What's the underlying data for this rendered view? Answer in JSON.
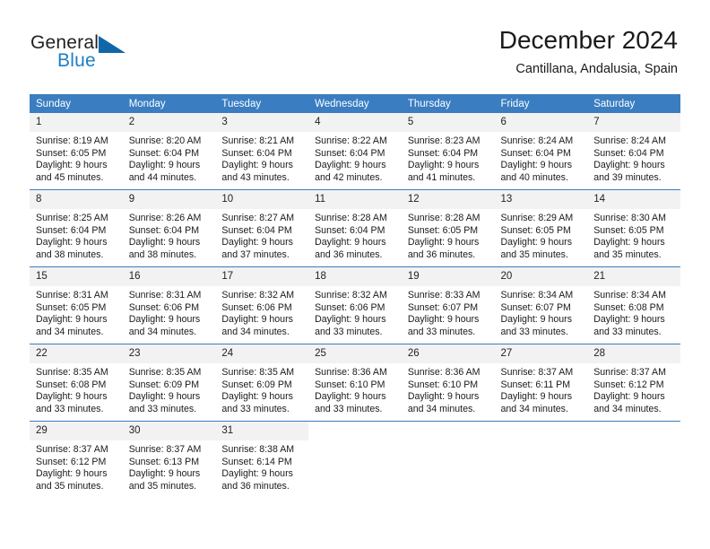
{
  "logo": {
    "word1": "General",
    "word2": "Blue",
    "triangle_color": "#1067a8",
    "blue_color": "#1b7fc4"
  },
  "header": {
    "title": "December 2024",
    "subtitle": "Cantillana, Andalusia, Spain"
  },
  "theme": {
    "header_blue": "#3a7dc1",
    "daynum_band": "#f2f2f2",
    "text": "#1a1a1a"
  },
  "weekday_headers": [
    "Sunday",
    "Monday",
    "Tuesday",
    "Wednesday",
    "Thursday",
    "Friday",
    "Saturday"
  ],
  "weeks": [
    [
      {
        "day": "1",
        "sunrise": "Sunrise: 8:19 AM",
        "sunset": "Sunset: 6:05 PM",
        "daylight_line1": "Daylight: 9 hours",
        "daylight_line2": "and 45 minutes."
      },
      {
        "day": "2",
        "sunrise": "Sunrise: 8:20 AM",
        "sunset": "Sunset: 6:04 PM",
        "daylight_line1": "Daylight: 9 hours",
        "daylight_line2": "and 44 minutes."
      },
      {
        "day": "3",
        "sunrise": "Sunrise: 8:21 AM",
        "sunset": "Sunset: 6:04 PM",
        "daylight_line1": "Daylight: 9 hours",
        "daylight_line2": "and 43 minutes."
      },
      {
        "day": "4",
        "sunrise": "Sunrise: 8:22 AM",
        "sunset": "Sunset: 6:04 PM",
        "daylight_line1": "Daylight: 9 hours",
        "daylight_line2": "and 42 minutes."
      },
      {
        "day": "5",
        "sunrise": "Sunrise: 8:23 AM",
        "sunset": "Sunset: 6:04 PM",
        "daylight_line1": "Daylight: 9 hours",
        "daylight_line2": "and 41 minutes."
      },
      {
        "day": "6",
        "sunrise": "Sunrise: 8:24 AM",
        "sunset": "Sunset: 6:04 PM",
        "daylight_line1": "Daylight: 9 hours",
        "daylight_line2": "and 40 minutes."
      },
      {
        "day": "7",
        "sunrise": "Sunrise: 8:24 AM",
        "sunset": "Sunset: 6:04 PM",
        "daylight_line1": "Daylight: 9 hours",
        "daylight_line2": "and 39 minutes."
      }
    ],
    [
      {
        "day": "8",
        "sunrise": "Sunrise: 8:25 AM",
        "sunset": "Sunset: 6:04 PM",
        "daylight_line1": "Daylight: 9 hours",
        "daylight_line2": "and 38 minutes."
      },
      {
        "day": "9",
        "sunrise": "Sunrise: 8:26 AM",
        "sunset": "Sunset: 6:04 PM",
        "daylight_line1": "Daylight: 9 hours",
        "daylight_line2": "and 38 minutes."
      },
      {
        "day": "10",
        "sunrise": "Sunrise: 8:27 AM",
        "sunset": "Sunset: 6:04 PM",
        "daylight_line1": "Daylight: 9 hours",
        "daylight_line2": "and 37 minutes."
      },
      {
        "day": "11",
        "sunrise": "Sunrise: 8:28 AM",
        "sunset": "Sunset: 6:04 PM",
        "daylight_line1": "Daylight: 9 hours",
        "daylight_line2": "and 36 minutes."
      },
      {
        "day": "12",
        "sunrise": "Sunrise: 8:28 AM",
        "sunset": "Sunset: 6:05 PM",
        "daylight_line1": "Daylight: 9 hours",
        "daylight_line2": "and 36 minutes."
      },
      {
        "day": "13",
        "sunrise": "Sunrise: 8:29 AM",
        "sunset": "Sunset: 6:05 PM",
        "daylight_line1": "Daylight: 9 hours",
        "daylight_line2": "and 35 minutes."
      },
      {
        "day": "14",
        "sunrise": "Sunrise: 8:30 AM",
        "sunset": "Sunset: 6:05 PM",
        "daylight_line1": "Daylight: 9 hours",
        "daylight_line2": "and 35 minutes."
      }
    ],
    [
      {
        "day": "15",
        "sunrise": "Sunrise: 8:31 AM",
        "sunset": "Sunset: 6:05 PM",
        "daylight_line1": "Daylight: 9 hours",
        "daylight_line2": "and 34 minutes."
      },
      {
        "day": "16",
        "sunrise": "Sunrise: 8:31 AM",
        "sunset": "Sunset: 6:06 PM",
        "daylight_line1": "Daylight: 9 hours",
        "daylight_line2": "and 34 minutes."
      },
      {
        "day": "17",
        "sunrise": "Sunrise: 8:32 AM",
        "sunset": "Sunset: 6:06 PM",
        "daylight_line1": "Daylight: 9 hours",
        "daylight_line2": "and 34 minutes."
      },
      {
        "day": "18",
        "sunrise": "Sunrise: 8:32 AM",
        "sunset": "Sunset: 6:06 PM",
        "daylight_line1": "Daylight: 9 hours",
        "daylight_line2": "and 33 minutes."
      },
      {
        "day": "19",
        "sunrise": "Sunrise: 8:33 AM",
        "sunset": "Sunset: 6:07 PM",
        "daylight_line1": "Daylight: 9 hours",
        "daylight_line2": "and 33 minutes."
      },
      {
        "day": "20",
        "sunrise": "Sunrise: 8:34 AM",
        "sunset": "Sunset: 6:07 PM",
        "daylight_line1": "Daylight: 9 hours",
        "daylight_line2": "and 33 minutes."
      },
      {
        "day": "21",
        "sunrise": "Sunrise: 8:34 AM",
        "sunset": "Sunset: 6:08 PM",
        "daylight_line1": "Daylight: 9 hours",
        "daylight_line2": "and 33 minutes."
      }
    ],
    [
      {
        "day": "22",
        "sunrise": "Sunrise: 8:35 AM",
        "sunset": "Sunset: 6:08 PM",
        "daylight_line1": "Daylight: 9 hours",
        "daylight_line2": "and 33 minutes."
      },
      {
        "day": "23",
        "sunrise": "Sunrise: 8:35 AM",
        "sunset": "Sunset: 6:09 PM",
        "daylight_line1": "Daylight: 9 hours",
        "daylight_line2": "and 33 minutes."
      },
      {
        "day": "24",
        "sunrise": "Sunrise: 8:35 AM",
        "sunset": "Sunset: 6:09 PM",
        "daylight_line1": "Daylight: 9 hours",
        "daylight_line2": "and 33 minutes."
      },
      {
        "day": "25",
        "sunrise": "Sunrise: 8:36 AM",
        "sunset": "Sunset: 6:10 PM",
        "daylight_line1": "Daylight: 9 hours",
        "daylight_line2": "and 33 minutes."
      },
      {
        "day": "26",
        "sunrise": "Sunrise: 8:36 AM",
        "sunset": "Sunset: 6:10 PM",
        "daylight_line1": "Daylight: 9 hours",
        "daylight_line2": "and 34 minutes."
      },
      {
        "day": "27",
        "sunrise": "Sunrise: 8:37 AM",
        "sunset": "Sunset: 6:11 PM",
        "daylight_line1": "Daylight: 9 hours",
        "daylight_line2": "and 34 minutes."
      },
      {
        "day": "28",
        "sunrise": "Sunrise: 8:37 AM",
        "sunset": "Sunset: 6:12 PM",
        "daylight_line1": "Daylight: 9 hours",
        "daylight_line2": "and 34 minutes."
      }
    ],
    [
      {
        "day": "29",
        "sunrise": "Sunrise: 8:37 AM",
        "sunset": "Sunset: 6:12 PM",
        "daylight_line1": "Daylight: 9 hours",
        "daylight_line2": "and 35 minutes."
      },
      {
        "day": "30",
        "sunrise": "Sunrise: 8:37 AM",
        "sunset": "Sunset: 6:13 PM",
        "daylight_line1": "Daylight: 9 hours",
        "daylight_line2": "and 35 minutes."
      },
      {
        "day": "31",
        "sunrise": "Sunrise: 8:38 AM",
        "sunset": "Sunset: 6:14 PM",
        "daylight_line1": "Daylight: 9 hours",
        "daylight_line2": "and 36 minutes."
      },
      {
        "day": "",
        "sunrise": "",
        "sunset": "",
        "daylight_line1": "",
        "daylight_line2": ""
      },
      {
        "day": "",
        "sunrise": "",
        "sunset": "",
        "daylight_line1": "",
        "daylight_line2": ""
      },
      {
        "day": "",
        "sunrise": "",
        "sunset": "",
        "daylight_line1": "",
        "daylight_line2": ""
      },
      {
        "day": "",
        "sunrise": "",
        "sunset": "",
        "daylight_line1": "",
        "daylight_line2": ""
      }
    ]
  ]
}
